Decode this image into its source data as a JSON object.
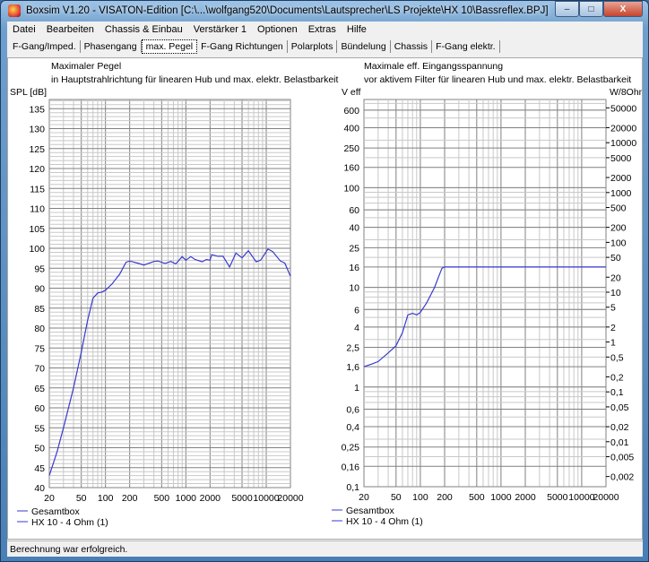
{
  "window": {
    "title": "Boxsim V1.20 - VISATON-Edition [C:\\...\\wolfgang520\\Documents\\Lautsprecher\\LS Projekte\\HX 10\\Bassreflex.BPJ]",
    "minimize": "–",
    "maximize": "□",
    "close": "X"
  },
  "menu": [
    "Datei",
    "Bearbeiten",
    "Chassis & Einbau",
    "Verstärker 1",
    "Optionen",
    "Extras",
    "Hilfe"
  ],
  "tabs": [
    "F-Gang/Imped.",
    "Phasengang",
    "max. Pegel",
    "F-Gang Richtungen",
    "Polarplots",
    "Bündelung",
    "Chassis",
    "F-Gang elektr."
  ],
  "active_tab": "max. Pegel",
  "status": "Berechnung war erfolgreich.",
  "colors": {
    "curve": "#3a3ad0",
    "grid_major": "#808080",
    "grid_minor": "#c8c8c8"
  },
  "chart_data": [
    {
      "type": "line",
      "title": "Maximaler Pegel",
      "subtitle": "in Hauptstrahlrichtung für linearen Hub und max. elektr. Belastbarkeit",
      "ylabel": "SPL [dB]",
      "xscale": "log",
      "xlim": [
        20,
        20000
      ],
      "ylim": [
        40,
        137
      ],
      "xticks": [
        "20",
        "50",
        "100",
        "200",
        "500",
        "1000",
        "2000",
        "5000",
        "10000",
        "20000"
      ],
      "yticks": [
        "135",
        "130",
        "125",
        "120",
        "115",
        "110",
        "105",
        "100",
        "95",
        "90",
        "85",
        "80",
        "75",
        "70",
        "65",
        "60",
        "55",
        "50",
        "45",
        "40"
      ],
      "legend": [
        "Gesamtbox",
        "HX 10 - 4 Ohm (1)"
      ],
      "series": [
        {
          "name": "Gesamtbox",
          "x": [
            20,
            25,
            30,
            40,
            50,
            60,
            70,
            80,
            90,
            100,
            120,
            150,
            180,
            200,
            250,
            300,
            400,
            450,
            550,
            650,
            750,
            900,
            1000,
            1150,
            1300,
            1600,
            1800,
            2000,
            2100,
            2500,
            2900,
            3500,
            4200,
            5000,
            6000,
            7500,
            8500,
            10500,
            12000,
            15000,
            17000,
            20000
          ],
          "y": [
            43,
            49,
            55,
            65,
            74,
            82,
            87.5,
            88.8,
            89,
            89.5,
            91,
            93.5,
            96.5,
            96.8,
            96.3,
            95.8,
            96.7,
            96.8,
            96.2,
            96.7,
            96.1,
            97.9,
            97,
            97.9,
            97.2,
            96.6,
            97.2,
            97,
            98.4,
            98,
            98,
            95.3,
            98.8,
            97.6,
            99.4,
            96.6,
            97,
            99.8,
            99.2,
            96.8,
            96.3,
            93
          ]
        }
      ]
    },
    {
      "type": "line",
      "title": "Maximale eff. Eingangsspannung",
      "subtitle": "vor aktivem Filter für linearen Hub und max. elektr. Belastbarkeit",
      "ylabel": "V eff",
      "y2label": "W/8Ohm",
      "xscale": "log",
      "yscale": "log",
      "xlim": [
        20,
        20000
      ],
      "ylim": [
        0.1,
        1000
      ],
      "xticks": [
        "20",
        "50",
        "100",
        "200",
        "500",
        "1000",
        "2000",
        "5000",
        "10000",
        "20000"
      ],
      "yticks": [
        "600",
        "400",
        "250",
        "160",
        "100",
        "60",
        "40",
        "25",
        "16",
        "10",
        "6",
        "4",
        "2,5",
        "1,6",
        "1",
        "0,6",
        "0,4",
        "0,25",
        "0,16",
        "0,1"
      ],
      "y2ticks": [
        "50000",
        "20000",
        "10000",
        "5000",
        "2000",
        "1000",
        "500",
        "200",
        "100",
        "50",
        "20",
        "10",
        "5",
        "2",
        "1",
        "0,5",
        "0,2",
        "0,1",
        "0,05",
        "0,02",
        "0,01",
        "0,005",
        "0,002"
      ],
      "legend": [
        "Gesamtbox",
        "HX 10 - 4 Ohm (1)"
      ],
      "series": [
        {
          "name": "Gesamtbox",
          "x": [
            20,
            25,
            30,
            40,
            50,
            60,
            70,
            80,
            90,
            100,
            120,
            150,
            170,
            185,
            200,
            20000
          ],
          "y": [
            1.6,
            1.7,
            1.8,
            2.2,
            2.6,
            3.5,
            5.3,
            5.5,
            5.3,
            5.6,
            7,
            10,
            13,
            15.5,
            16,
            16
          ]
        }
      ]
    }
  ]
}
